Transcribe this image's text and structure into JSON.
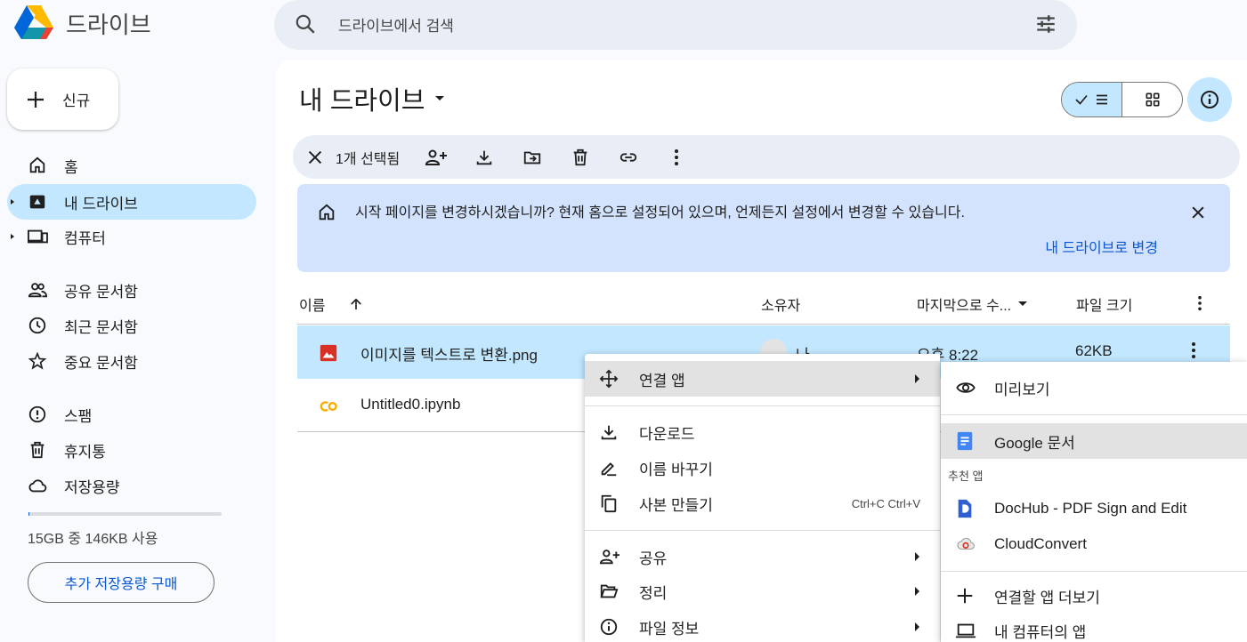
{
  "app": {
    "brand": "드라이브"
  },
  "search": {
    "placeholder": "드라이브에서 검색"
  },
  "sidebar": {
    "new_label": "신규",
    "items": [
      {
        "label": "홈",
        "icon": "home-icon"
      },
      {
        "label": "내 드라이브",
        "icon": "drive-icon",
        "active": true
      },
      {
        "label": "컴퓨터",
        "icon": "computer-icon"
      },
      {
        "label": "공유 문서함",
        "icon": "people-icon"
      },
      {
        "label": "최근 문서함",
        "icon": "clock-icon"
      },
      {
        "label": "중요 문서함",
        "icon": "star-icon"
      },
      {
        "label": "스팸",
        "icon": "spam-icon"
      },
      {
        "label": "휴지통",
        "icon": "trash-icon"
      },
      {
        "label": "저장용량",
        "icon": "cloud-icon"
      }
    ],
    "storage_text": "15GB 중 146KB 사용",
    "storage_fraction": 0.0001,
    "buy_label": "추가 저장용량 구매"
  },
  "main": {
    "title": "내 드라이브",
    "selection": {
      "count_label": "1개 선택됨"
    },
    "banner": {
      "message": "시작 페이지를 변경하시겠습니까? 현재 홈으로 설정되어 있으며, 언제든지 설정에서 변경할 수 있습니다.",
      "action": "내 드라이브로 변경"
    },
    "columns": {
      "name": "이름",
      "owner": "소유자",
      "modified": "마지막으로 수...",
      "size": "파일 크기"
    },
    "files": [
      {
        "name": "이미지를 텍스트로 변환.png",
        "owner": "나",
        "modified": "오후 8:22",
        "size": "62KB",
        "selected": true,
        "icon": "image-file-icon"
      },
      {
        "name": "Untitled0.ipynb",
        "icon": "colab-file-icon"
      }
    ]
  },
  "context_menu": {
    "open_with": "연결 앱",
    "download": "다운로드",
    "rename": "이름 바꾸기",
    "copy": "사본 만들기",
    "copy_shortcut": "Ctrl+C Ctrl+V",
    "share": "공유",
    "organize": "정리",
    "file_info": "파일 정보"
  },
  "submenu": {
    "preview": "미리보기",
    "google_docs": "Google 문서",
    "suggested_caption": "추천 앱",
    "dochub": "DocHub - PDF Sign and Edit",
    "cloudconvert": "CloudConvert",
    "more_apps": "연결할 앱 더보기",
    "computer_apps": "내 컴퓨터의 앱"
  },
  "colors": {
    "accent": "#0b57d0",
    "selected_bg": "#c2e7ff",
    "banner_bg": "#d3e3fd"
  }
}
